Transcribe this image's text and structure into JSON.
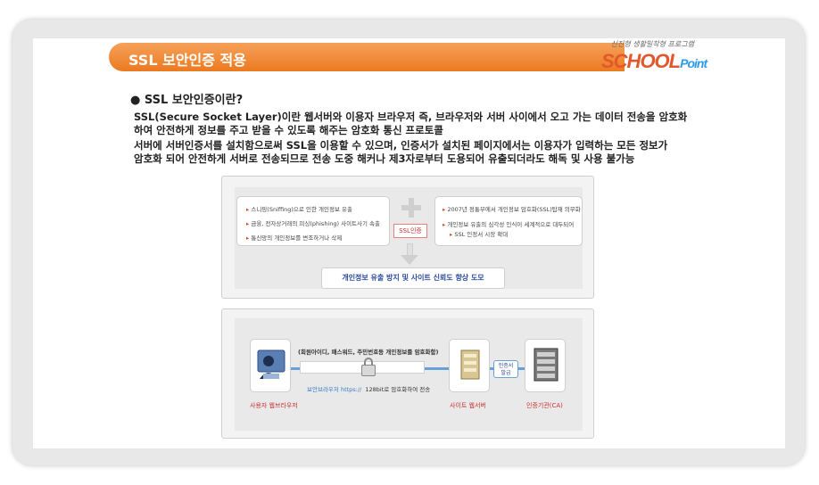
{
  "banner": {
    "title": "SSL 보안인증 적용"
  },
  "logo": {
    "subtitle": "신진형 생활밀착형 프로그램",
    "main": "SCHOOL",
    "suffix": "Point"
  },
  "section": {
    "heading": "● SSL 보안인증이란?",
    "para1_line1": "SSL(Secure Socket Layer)이란 웹서버와 이용자 브라우저 즉, 브라우저와 서버 사이에서 오고 가는 데이터 전송을 암호화",
    "para1_line2": "하여 안전하게 정보를 주고 받을 수 있도록 해주는 암호화 통신 프로토콜",
    "para2_line1": "서버에 서버인증서를 설치함으로써 SSL을 이용할 수 있으며, 인증서가 설치된 페이지에서는 이용자가 입력하는 모든 정보가",
    "para2_line2": "암호화 되어 안전하게 서버로 전송되므로 전송 도중 해커나 제3자로부터 도용되어 유출되더라도 해독 및 사용 불가능"
  },
  "diagram1": {
    "left_items": [
      "스니핑(Sniffing)으로 인한 개인정보 유출",
      "금융, 전자상거래의 피싱(phishing)  사이트사기 속출",
      "통신망의 개인정보를 변조하거나 삭제"
    ],
    "right_items": [
      "2007년 정통부에서 개인정보 암호화(SSL)탑재 의무화",
      "개인정보 유출의 심각성 인식이 세계적으로 대두되어",
      "SSL 인정서 시장 확대"
    ],
    "badge": "SSL인증",
    "result": "개인정보 유출 방지 및 사이트 신뢰도 향상 도모"
  },
  "diagram2": {
    "top_caption": "(회원아이디, 패스워드, 주민번호등 개인정보를 암호화함)",
    "bottom_caption_blue": "보안브라우저 https://",
    "bottom_caption_rest": "128bit로 암호화하여 전송",
    "user_label": "사용자 웹브라우저",
    "web_label": "사이트 웹서버",
    "ca_label": "인증기관(CA)",
    "cert_line1": "인증서",
    "cert_line2": "발급"
  }
}
